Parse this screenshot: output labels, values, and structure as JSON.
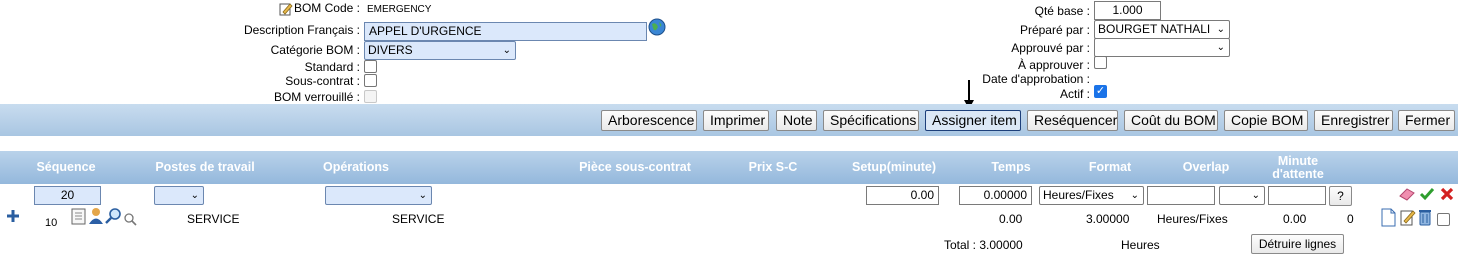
{
  "header": {
    "bom_code_label": "BOM Code :",
    "bom_code_value": "EMERGENCY",
    "description_label": "Description Français :",
    "description_value": "APPEL D'URGENCE",
    "category_label": "Catégorie BOM :",
    "category_value": "DIVERS",
    "standard_label": "Standard :",
    "subcontract_label": "Sous-contrat :",
    "locked_label": "BOM verrouillé :",
    "qty_label": "Qté base :",
    "qty_value": "1.000",
    "prepared_label": "Préparé par :",
    "prepared_value": "BOURGET NATHALI",
    "approved_label": "Approuvé par :",
    "approved_value": "",
    "to_approve_label": "À approuver :",
    "approval_date_label": "Date d'approbation :",
    "active_label": "Actif :"
  },
  "toolbar": {
    "buttons": [
      "Arborescence",
      "Imprimer",
      "Note",
      "Spécifications",
      "Assigner item",
      "Reséquencer",
      "Coût du BOM",
      "Copie BOM",
      "Enregistrer",
      "Fermer"
    ]
  },
  "table": {
    "headers": {
      "sequence": "Séquence",
      "workstations": "Postes de travail",
      "operations": "Opérations",
      "subcontract_part": "Pièce sous-contrat",
      "sc_price": "Prix S-C",
      "setup": "Setup(minute)",
      "time": "Temps",
      "format": "Format",
      "overlap": "Overlap",
      "wait_minutes_1": "Minute",
      "wait_minutes_2": "d'attente"
    },
    "new_row": {
      "sequence": "20",
      "setup": "0.00",
      "time": "0.00000",
      "format": "Heures/Fixes",
      "help": "?"
    },
    "rows": [
      {
        "sequence": "10",
        "workstation": "SERVICE",
        "operation": "SERVICE",
        "setup": "0.00",
        "time": "3.00000",
        "format": "Heures/Fixes",
        "wait": "0.00",
        "extra": "0"
      }
    ],
    "total_label": "Total : 3.00000",
    "total_unit": "Heures",
    "delete_lines": "Détruire lignes"
  },
  "colors": {
    "toolbar": "#a9c6e2",
    "header_band": "#94b8dc",
    "input_blue": "#dbe8fb"
  }
}
